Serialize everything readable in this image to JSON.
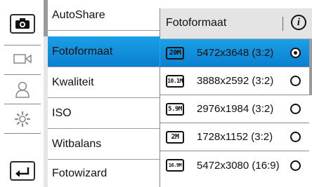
{
  "menu": {
    "items": [
      {
        "label": "AutoShare"
      },
      {
        "label": "Fotoformaat"
      },
      {
        "label": "Kwaliteit"
      },
      {
        "label": "ISO"
      },
      {
        "label": "Witbalans"
      },
      {
        "label": "Fotowizard"
      }
    ],
    "selected_index": 1
  },
  "popup": {
    "title": "Fotoformaat",
    "options": [
      {
        "badge": "20M",
        "label": "5472x3648 (3:2)",
        "selected": true
      },
      {
        "badge": "10.1M",
        "label": "3888x2592 (3:2)",
        "selected": false
      },
      {
        "badge": "5.9M",
        "label": "2976x1984 (3:2)",
        "selected": false
      },
      {
        "badge": "2M",
        "label": "1728x1152 (3:2)",
        "selected": false
      },
      {
        "badge": "16.9M",
        "label": "5472x3080 (16:9)",
        "selected": false
      }
    ]
  },
  "sidebar": {
    "icons": [
      "camera-icon",
      "video-camera-icon",
      "user-icon",
      "settings-icon",
      "back-icon"
    ],
    "active": "camera-icon"
  },
  "colors": {
    "selection": "#0a8fdc"
  }
}
